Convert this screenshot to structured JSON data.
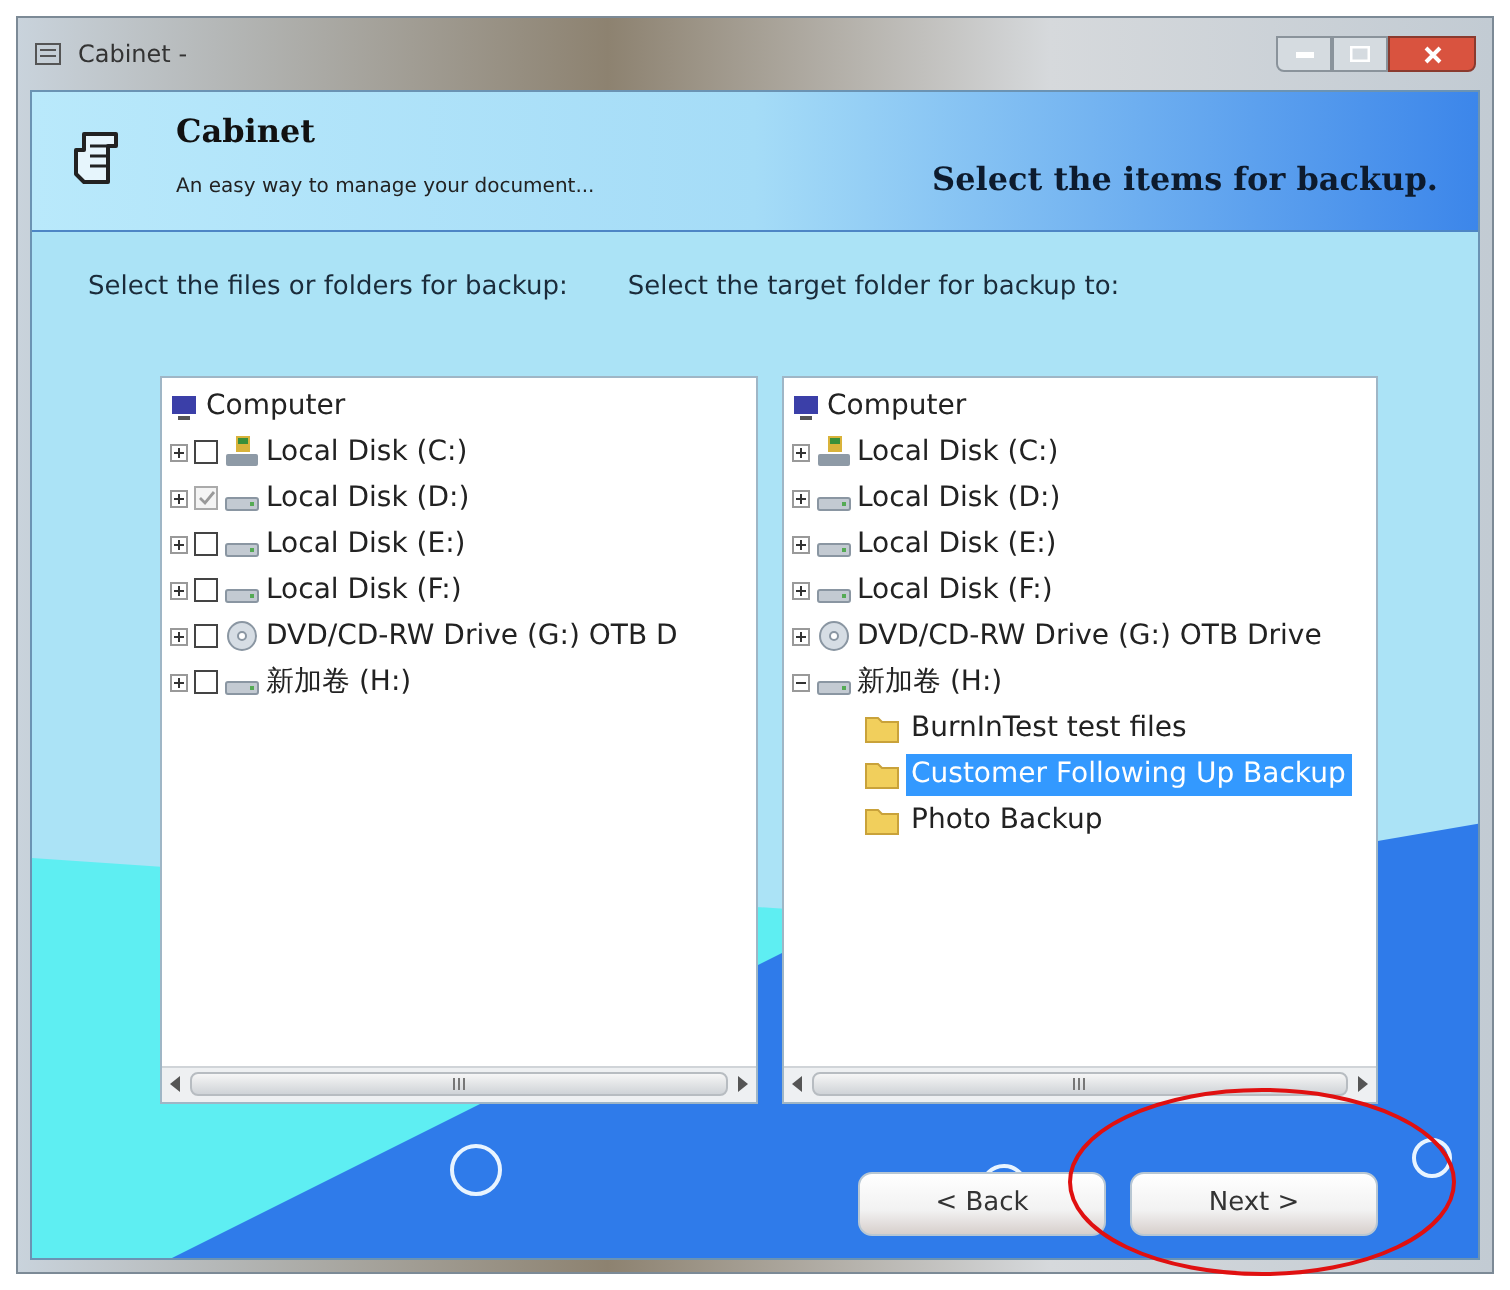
{
  "window": {
    "title": "Cabinet -"
  },
  "header": {
    "app_name": "Cabinet",
    "tagline": "An easy way to manage your document...",
    "step_title": "Select the items for backup."
  },
  "source": {
    "label": "Select the files or folders for backup:",
    "root": "Computer",
    "items": [
      {
        "label": "Local Disk (C:)",
        "kind": "system-disk",
        "checked": false,
        "expanded": false
      },
      {
        "label": "Local Disk (D:)",
        "kind": "disk",
        "checked": true,
        "expanded": false
      },
      {
        "label": "Local Disk (E:)",
        "kind": "disk",
        "checked": false,
        "expanded": false
      },
      {
        "label": "Local Disk (F:)",
        "kind": "disk",
        "checked": false,
        "expanded": false
      },
      {
        "label": "DVD/CD-RW Drive (G:) OTB D",
        "kind": "optical",
        "checked": false,
        "expanded": false
      },
      {
        "label": "新加卷 (H:)",
        "kind": "disk",
        "checked": false,
        "expanded": false
      }
    ]
  },
  "target": {
    "label": "Select the target folder for backup to:",
    "root": "Computer",
    "items": [
      {
        "label": "Local Disk (C:)",
        "kind": "system-disk",
        "expanded": false
      },
      {
        "label": "Local Disk (D:)",
        "kind": "disk",
        "expanded": false
      },
      {
        "label": "Local Disk (E:)",
        "kind": "disk",
        "expanded": false
      },
      {
        "label": "Local Disk (F:)",
        "kind": "disk",
        "expanded": false
      },
      {
        "label": "DVD/CD-RW Drive (G:) OTB Drive",
        "kind": "optical",
        "expanded": false
      },
      {
        "label": "新加卷 (H:)",
        "kind": "disk",
        "expanded": true,
        "children": [
          {
            "label": "BurnInTest test files",
            "selected": false
          },
          {
            "label": "Customer Following Up Backup",
            "selected": true
          },
          {
            "label": "Photo Backup",
            "selected": false
          }
        ]
      }
    ]
  },
  "buttons": [
    {
      "label": "< Back"
    },
    {
      "label": "Next >"
    }
  ]
}
